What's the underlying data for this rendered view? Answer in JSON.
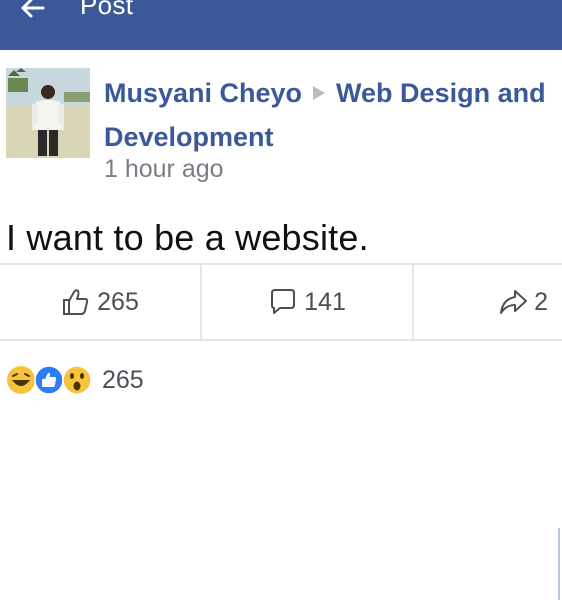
{
  "header": {
    "title": "Post",
    "back_icon": "back-arrow-icon",
    "bar_color": "#3b5998"
  },
  "post": {
    "author": "Musyani Cheyo",
    "group_part1": "Web Design and",
    "group_part2": "Development",
    "timestamp": "1 hour ago",
    "text": "I want to be a website."
  },
  "actions": {
    "likes": "265",
    "comments": "141",
    "shares": "2"
  },
  "reactions": {
    "types": [
      "haha",
      "like",
      "wow"
    ],
    "count": "265"
  },
  "colors": {
    "link": "#3b5998",
    "muted": "#7a7d83"
  }
}
